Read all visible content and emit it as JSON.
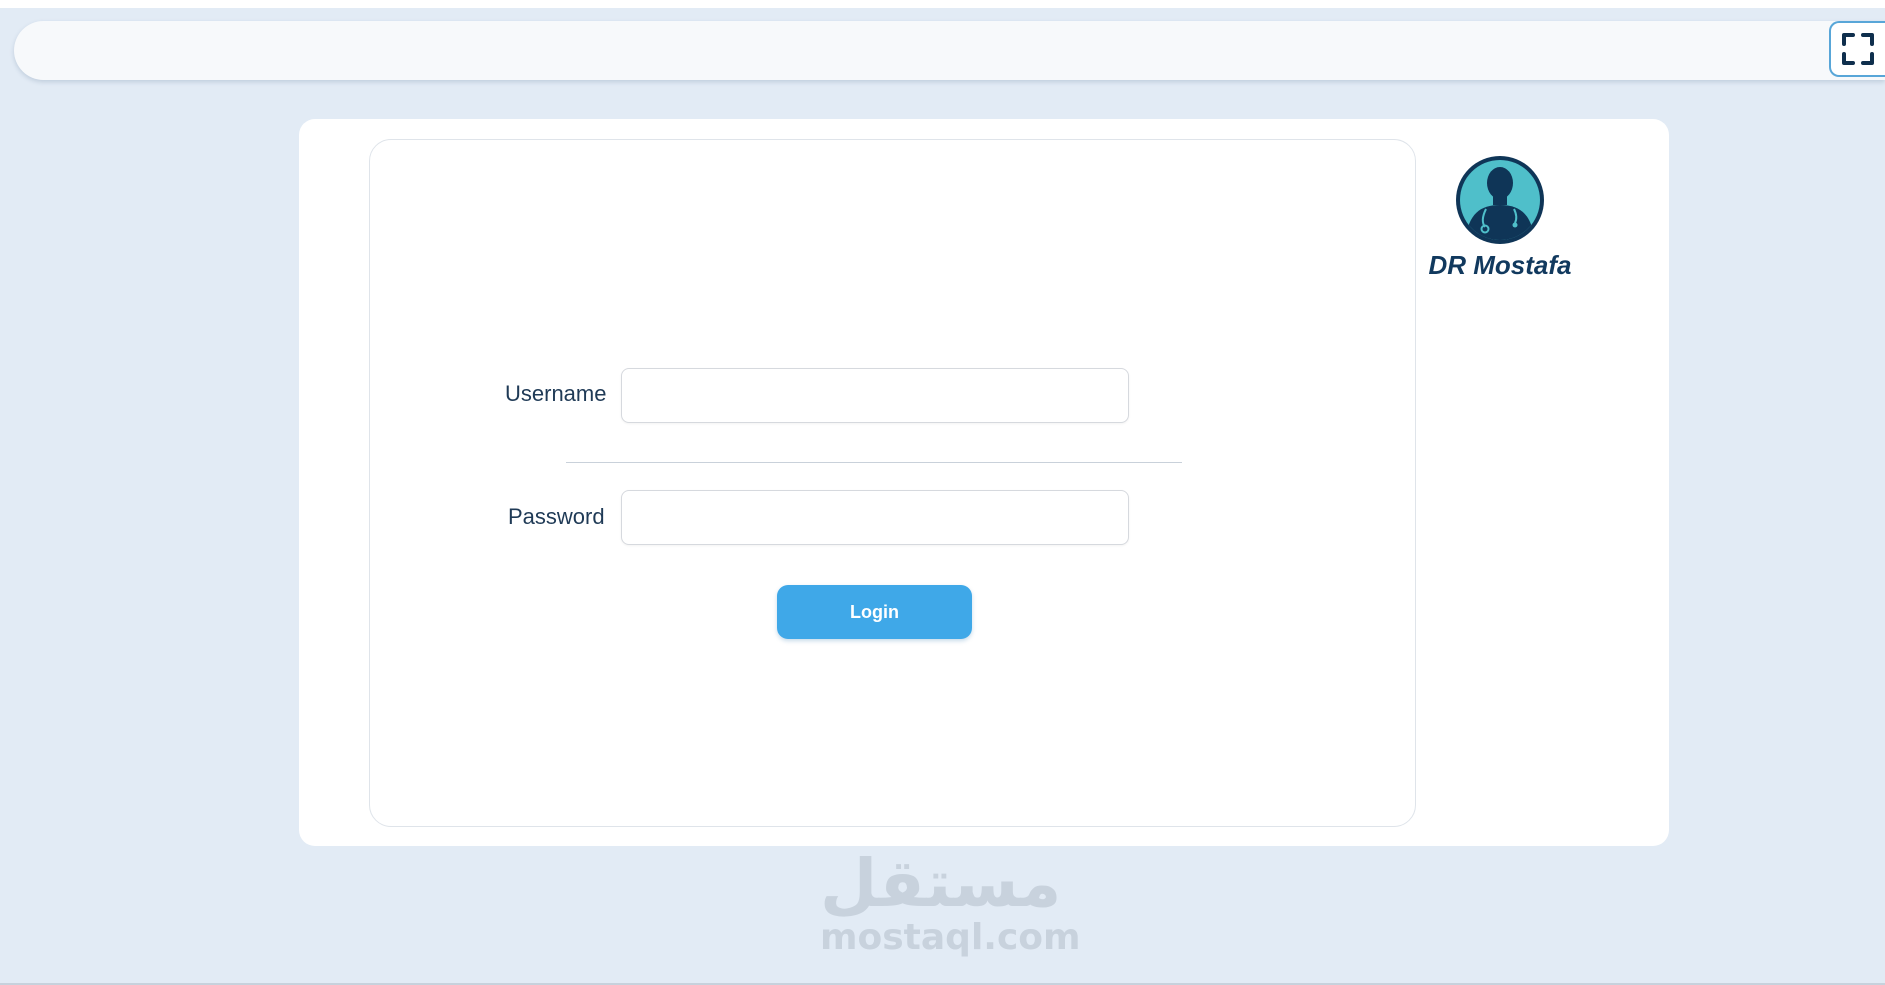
{
  "header": {
    "fullscreen_icon": "fullscreen-expand-icon"
  },
  "login_form": {
    "username_label": "Username",
    "username_value": "",
    "password_label": "Password",
    "password_value": "",
    "login_button_label": "Login"
  },
  "brand": {
    "logo_icon": "doctor-avatar-icon",
    "name": "DR Mostafa"
  },
  "watermark": {
    "arabic": "مستقل",
    "latin": "mostaql.com"
  },
  "colors": {
    "page_background": "#e2ebf5",
    "accent": "#3fa8e8",
    "brand_text": "#11395e",
    "logo_teal": "#4fbfca",
    "logo_navy": "#0f3557"
  }
}
